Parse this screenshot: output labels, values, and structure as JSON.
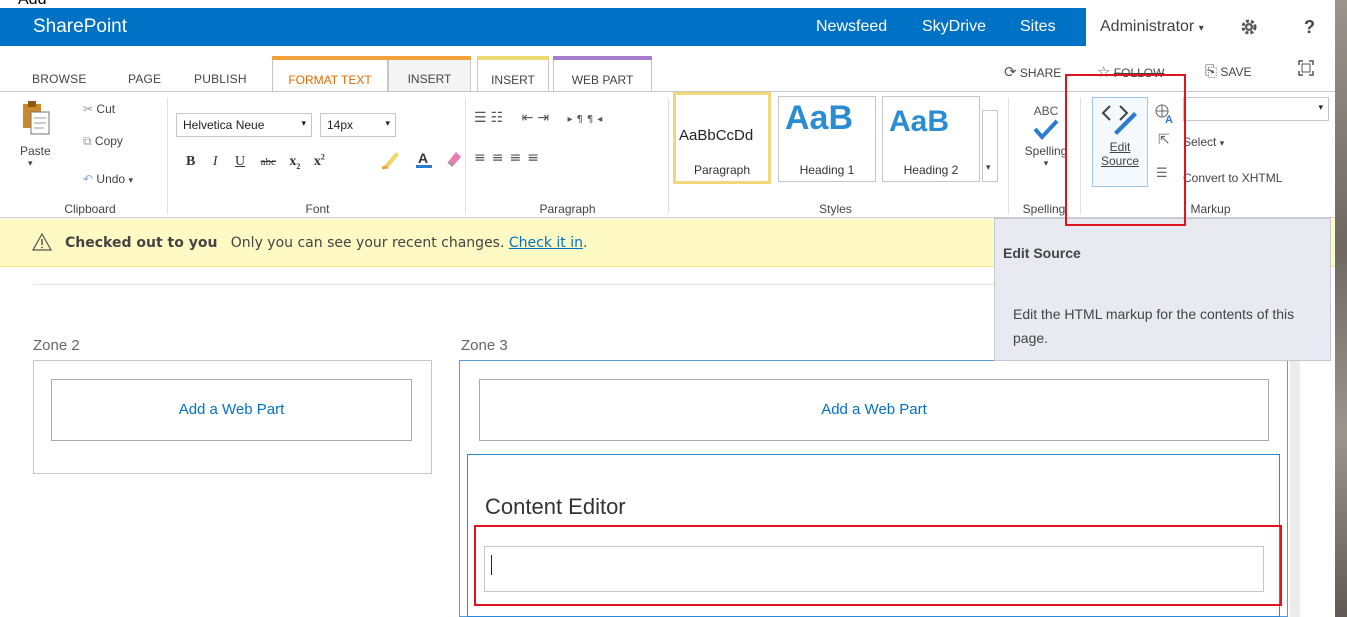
{
  "caption": "Add",
  "suite_bar": {
    "brand": "SharePoint",
    "links": [
      "Newsfeed",
      "SkyDrive",
      "Sites"
    ],
    "user": "Administrator",
    "help": "?"
  },
  "ribbon_tabs": {
    "browse": "BROWSE",
    "page": "PAGE",
    "publish": "PUBLISH",
    "format_text": "FORMAT TEXT",
    "insert": "INSERT",
    "insert2": "INSERT",
    "web_part": "WEB PART"
  },
  "top_actions": {
    "share": "SHARE",
    "follow": "FOLLOW",
    "save": "SAVE"
  },
  "clipboard": {
    "paste": "Paste",
    "cut": "Cut",
    "copy": "Copy",
    "undo": "Undo",
    "label": "Clipboard"
  },
  "font": {
    "family": "Helvetica Neue",
    "size": "14px",
    "label": "Font"
  },
  "paragraph": {
    "label": "Paragraph"
  },
  "styles": {
    "label": "Styles",
    "items": [
      {
        "sample": "AaBbCcDd",
        "caption": "Paragraph"
      },
      {
        "sample": "AaB",
        "caption": "Heading 1"
      },
      {
        "sample": "AaB",
        "caption": "Heading 2"
      }
    ]
  },
  "spelling": {
    "abc": "ABC",
    "button": "Spelling",
    "label": "Spelling"
  },
  "markup": {
    "edit": "Edit",
    "source": "Source",
    "select": "Select",
    "convert": "Convert to XHTML",
    "label": "Markup"
  },
  "notification": {
    "bold": "Checked out to you",
    "text": "Only you can see your recent changes.",
    "link": "Check it in",
    "period": "."
  },
  "tooltip": {
    "title": "Edit Source",
    "description": "Edit the HTML markup for the contents of this page."
  },
  "zones": {
    "zone2_title": "Zone 2",
    "zone3_title": "Zone 3",
    "add_web_part": "Add a Web Part",
    "content_editor_title": "Content Editor"
  },
  "colors": {
    "suite_bar": "#0072c6",
    "format_text_tab": "#f3a13c",
    "insert_tab": "#f0d873",
    "web_part_tab": "#a67ccf",
    "highlight": "#e0141e",
    "notification": "#fff9c4"
  }
}
